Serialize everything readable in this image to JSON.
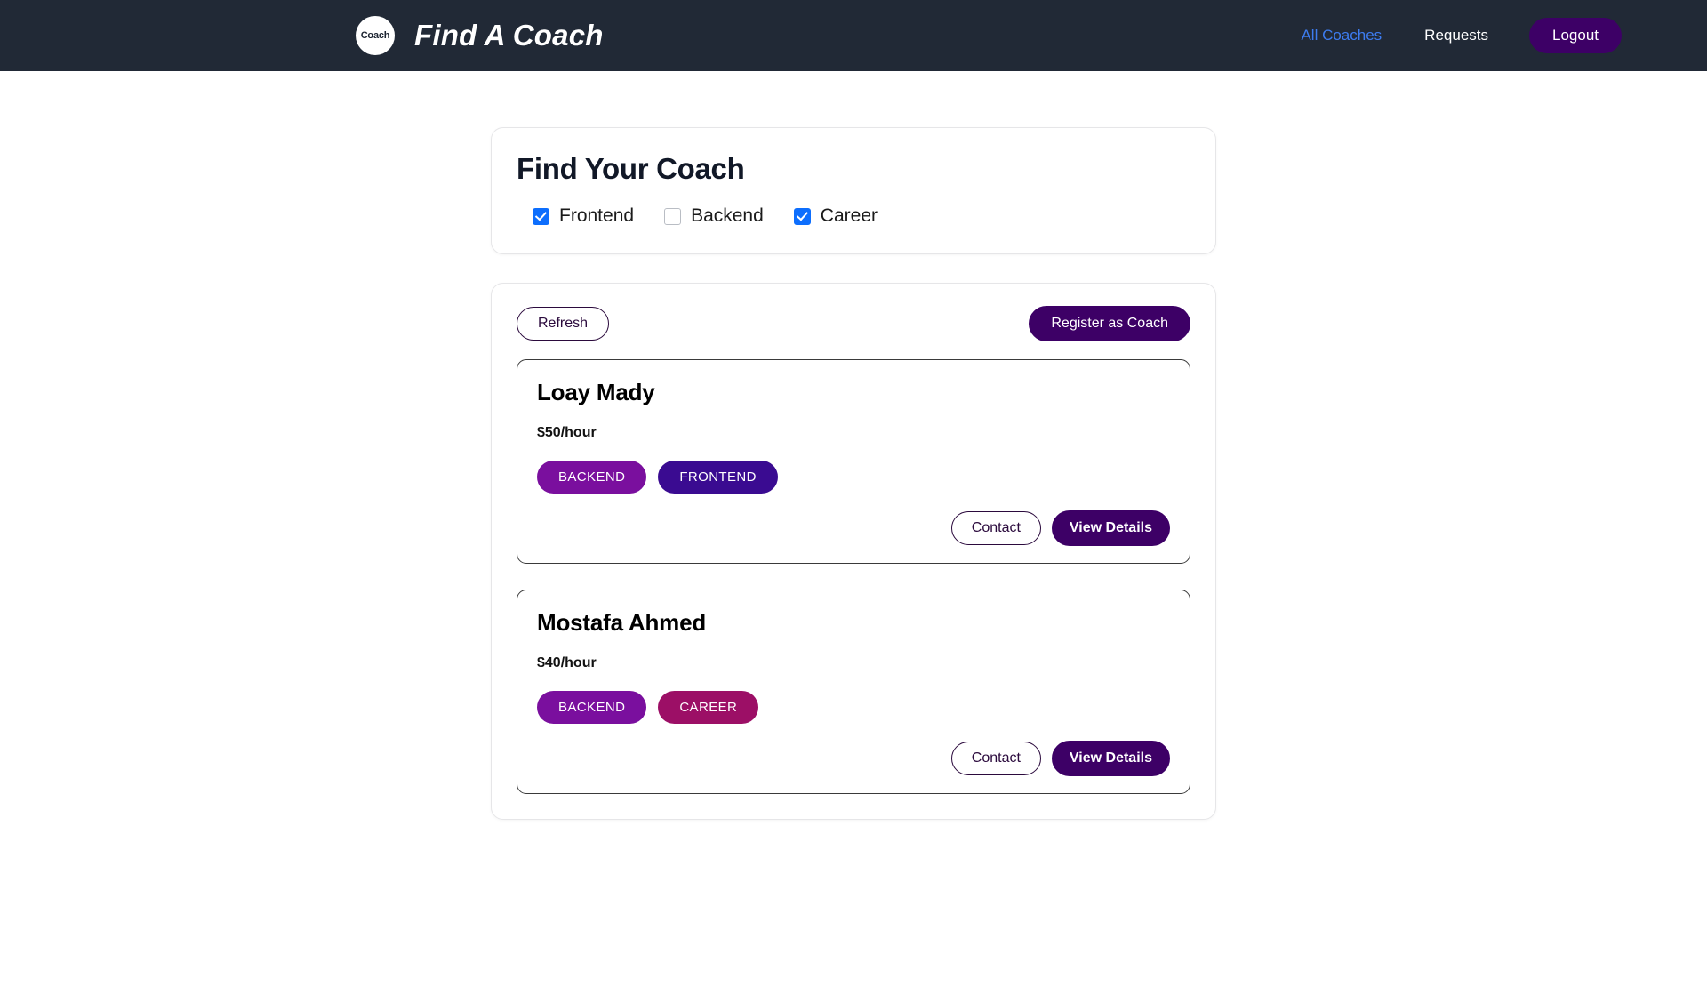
{
  "header": {
    "logo_text": "Coach",
    "logo_icon": "coach-circle-logo",
    "title": "Find A Coach",
    "nav": [
      {
        "label": "All Coaches",
        "active": true
      },
      {
        "label": "Requests",
        "active": false
      }
    ],
    "logout_label": "Logout",
    "background_color": "#212936",
    "active_link_color": "#3d7cf0",
    "logout_color": "#3d0066"
  },
  "filter": {
    "title": "Find Your Coach",
    "options": [
      {
        "label": "Frontend",
        "checked": true
      },
      {
        "label": "Backend",
        "checked": false
      },
      {
        "label": "Career",
        "checked": true
      }
    ],
    "checked_color": "#0d6efd"
  },
  "toolbar": {
    "refresh_label": "Refresh",
    "register_label": "Register as Coach"
  },
  "coaches": [
    {
      "name": "Loay Mady",
      "rate": "$50/hour",
      "tags": [
        {
          "label": "BACKEND",
          "color": "#7a0f9e"
        },
        {
          "label": "FRONTEND",
          "color": "#3a0b91"
        }
      ],
      "contact_label": "Contact",
      "details_label": "View Details"
    },
    {
      "name": "Mostafa Ahmed",
      "rate": "$40/hour",
      "tags": [
        {
          "label": "BACKEND",
          "color": "#7a0f9e"
        },
        {
          "label": "CAREER",
          "color": "#9c0f66"
        }
      ],
      "contact_label": "Contact",
      "details_label": "View Details"
    }
  ]
}
